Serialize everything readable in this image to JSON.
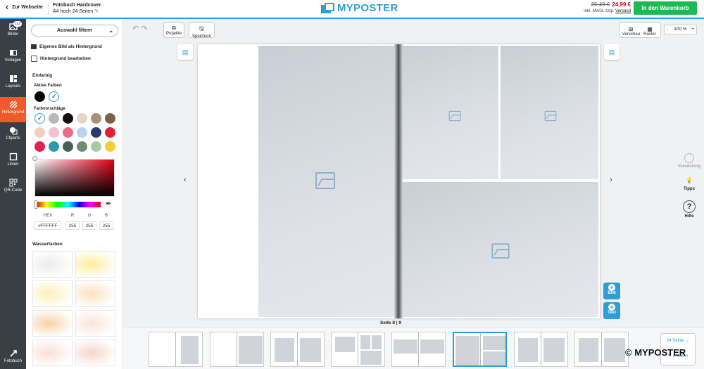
{
  "header": {
    "back_label": "Zur Webseite",
    "product_title": "Fotobuch Hardcover",
    "product_subtitle": "A4 hoch 24 Seiten",
    "brand": "MYPOSTER",
    "price_old": "35,49 €",
    "price_new": "24,99 €",
    "vat_text": "inkl. MwSt. zzgl.",
    "shipping_link": "Versand",
    "cart_button": "In den Warenkorb"
  },
  "leftnav": {
    "badge": "112",
    "items": [
      {
        "label": "Bilder",
        "icon": "images-icon"
      },
      {
        "label": "Vorlagen",
        "icon": "templates-icon"
      },
      {
        "label": "Layouts",
        "icon": "layouts-icon"
      },
      {
        "label": "Hintergrund",
        "icon": "background-icon"
      },
      {
        "label": "Cliparts",
        "icon": "cliparts-icon"
      },
      {
        "label": "Linien",
        "icon": "lines-icon"
      },
      {
        "label": "QR-Code",
        "icon": "qr-code-icon"
      },
      {
        "label": "Fotobuch",
        "icon": "photobook-icon"
      }
    ]
  },
  "panel": {
    "filter_label": "Auswahl filtern",
    "own_image_bg": "Eigenes Bild als Hintergrund",
    "edit_bg": "Hintergrund bearbeiten",
    "solid_heading": "Einfarbig",
    "active_colors": "Aktive Farben",
    "suggestions": "Farbvorschläge",
    "hex_label": "HEX",
    "r_label": "R",
    "g_label": "G",
    "b_label": "B",
    "hex_value": "#FFFFFF",
    "r_value": "255",
    "g_value": "255",
    "b_value": "255",
    "watercolor_heading": "Wasserfarben",
    "active_swatches": [
      "#000000",
      "#ffffff"
    ],
    "suggestion_swatches": [
      "#ffffff",
      "#b8b8b8",
      "#111111",
      "#e6d6c6",
      "#a78f7c",
      "#7d6048",
      "#f3cdbd",
      "#f5c0cf",
      "#ef6b8a",
      "#b9d4ef",
      "#283a6e",
      "#e0203a",
      "#e02050",
      "#2a9aa8",
      "#45605a",
      "#6f8a7a",
      "#aacaa6",
      "#f2d035"
    ],
    "watercolor_tints": [
      "#ececec",
      "#fbef9a",
      "#fdf0b8",
      "#fbe1c0",
      "#f8d2a4",
      "#fbe4da",
      "#f9e0d8",
      "#f5d6c8"
    ]
  },
  "workspace": {
    "projects_label": "Projekte",
    "save_label": "Speichern",
    "preview_label": "Vorschau",
    "grid_label": "Raster",
    "zoom_value": "100 %",
    "zoom_minus": "-",
    "zoom_plus": "+",
    "page_indicator": "Seite 8 | 9",
    "add_image": "Bild",
    "add_text": "Text",
    "finishing": "Veredelung",
    "tips": "Tipps",
    "help": "Hilfe"
  },
  "filmstrip": {
    "pages_count": "24 Seiten",
    "add_pages": "2 Seiten",
    "selected_index": 5
  },
  "watermark": "© MYPOSTER"
}
